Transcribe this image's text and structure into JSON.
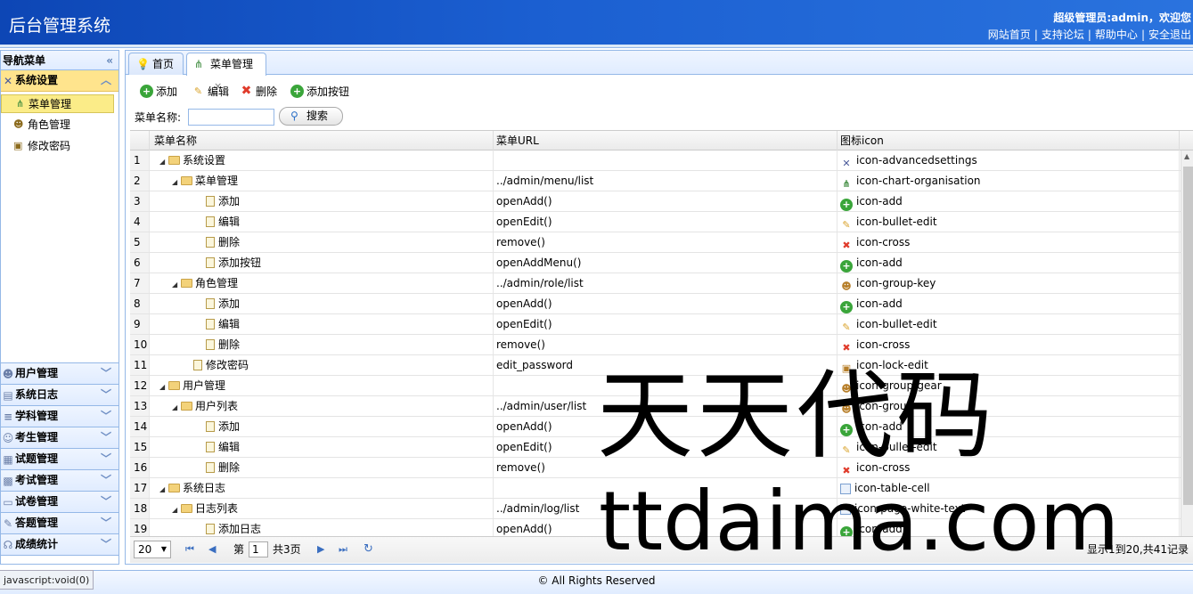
{
  "header": {
    "app_title": "后台管理系统",
    "welcome": "超级管理员:admin，欢迎您",
    "links": [
      "网站首页",
      "支持论坛",
      "帮助中心",
      "安全退出"
    ]
  },
  "sidebar": {
    "title": "导航菜单",
    "collapse_icon": "«",
    "active_group": "系统设置",
    "tree_items": [
      "菜单管理",
      "角色管理",
      "修改密码"
    ],
    "groups": [
      "用户管理",
      "系统日志",
      "学科管理",
      "考生管理",
      "试题管理",
      "考试管理",
      "试卷管理",
      "答题管理",
      "成绩统计"
    ]
  },
  "tabs": [
    {
      "label": "首页",
      "icon": "lightbulb-icon"
    },
    {
      "label": "菜单管理",
      "icon": "chart-organisation-icon",
      "close": "×"
    }
  ],
  "toolbar": {
    "add": "添加",
    "edit": "编辑",
    "delete": "删除",
    "add_button": "添加按钮",
    "search_label": "菜单名称:",
    "search_value": "",
    "search_button": "搜索"
  },
  "grid": {
    "columns": [
      "菜单名称",
      "菜单URL",
      "图标icon"
    ],
    "rows": [
      {
        "no": "1",
        "name": "系统设置",
        "url": "",
        "icon": "icon-advancedsettings",
        "level": 0,
        "type": "folder"
      },
      {
        "no": "2",
        "name": "菜单管理",
        "url": "../admin/menu/list",
        "icon": "icon-chart-organisation",
        "level": 1,
        "type": "folder"
      },
      {
        "no": "3",
        "name": "添加",
        "url": "openAdd()",
        "icon": "icon-add",
        "level": 2,
        "type": "leaf"
      },
      {
        "no": "4",
        "name": "编辑",
        "url": "openEdit()",
        "icon": "icon-bullet-edit",
        "level": 2,
        "type": "leaf"
      },
      {
        "no": "5",
        "name": "删除",
        "url": "remove()",
        "icon": "icon-cross",
        "level": 2,
        "type": "leaf"
      },
      {
        "no": "6",
        "name": "添加按钮",
        "url": "openAddMenu()",
        "icon": "icon-add",
        "level": 2,
        "type": "leaf"
      },
      {
        "no": "7",
        "name": "角色管理",
        "url": "../admin/role/list",
        "icon": "icon-group-key",
        "level": 1,
        "type": "folder"
      },
      {
        "no": "8",
        "name": "添加",
        "url": "openAdd()",
        "icon": "icon-add",
        "level": 2,
        "type": "leaf"
      },
      {
        "no": "9",
        "name": "编辑",
        "url": "openEdit()",
        "icon": "icon-bullet-edit",
        "level": 2,
        "type": "leaf"
      },
      {
        "no": "10",
        "name": "删除",
        "url": "remove()",
        "icon": "icon-cross",
        "level": 2,
        "type": "leaf"
      },
      {
        "no": "11",
        "name": "修改密码",
        "url": "edit_password",
        "icon": "icon-lock-edit",
        "level": 1,
        "type": "leaf"
      },
      {
        "no": "12",
        "name": "用户管理",
        "url": "",
        "icon": "icon-group-gear",
        "level": 0,
        "type": "folder"
      },
      {
        "no": "13",
        "name": "用户列表",
        "url": "../admin/user/list",
        "icon": "icon-group",
        "level": 1,
        "type": "folder"
      },
      {
        "no": "14",
        "name": "添加",
        "url": "openAdd()",
        "icon": "icon-add",
        "level": 2,
        "type": "leaf"
      },
      {
        "no": "15",
        "name": "编辑",
        "url": "openEdit()",
        "icon": "icon-bullet-edit",
        "level": 2,
        "type": "leaf"
      },
      {
        "no": "16",
        "name": "删除",
        "url": "remove()",
        "icon": "icon-cross",
        "level": 2,
        "type": "leaf"
      },
      {
        "no": "17",
        "name": "系统日志",
        "url": "",
        "icon": "icon-table-cell",
        "level": 0,
        "type": "folder"
      },
      {
        "no": "18",
        "name": "日志列表",
        "url": "../admin/log/list",
        "icon": "icon-page-white-text",
        "level": 1,
        "type": "folder"
      },
      {
        "no": "19",
        "name": "添加日志",
        "url": "openAdd()",
        "icon": "icon-add1",
        "level": 2,
        "type": "leaf"
      }
    ]
  },
  "pager": {
    "page_size": "20",
    "page_label": "第",
    "page_value": "1",
    "total_pages": "共3页",
    "info": "显示1到20,共41记录"
  },
  "footer": {
    "copyright": "© All Rights Reserved",
    "status": "javascript:void(0)"
  },
  "watermark": {
    "line1": "天天代码",
    "line2": "ttdaima.com"
  }
}
